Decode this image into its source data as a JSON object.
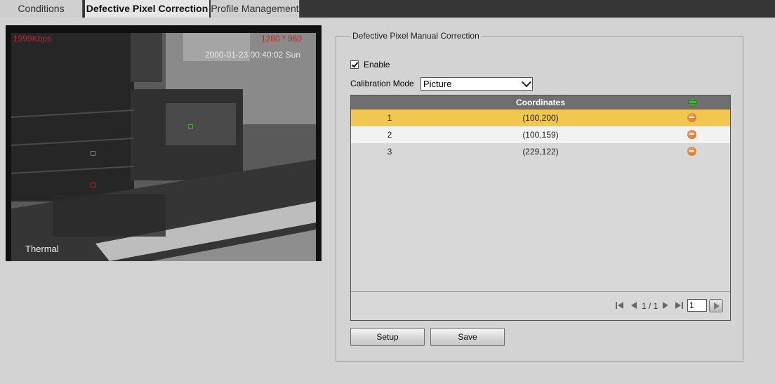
{
  "tabs": [
    {
      "label": "Conditions",
      "active": false
    },
    {
      "label": "Defective Pixel Correction",
      "active": true
    },
    {
      "label": "Profile Management",
      "active": false
    }
  ],
  "video": {
    "bitrate": "1999Kbps",
    "resolution": "1280 * 960",
    "timestamp": "2000-01-23 00:40:02 Sun",
    "channel": "Thermal"
  },
  "panel": {
    "legend": "Defective Pixel Manual Correction",
    "enable_label": "Enable",
    "enable_checked": true,
    "calibration_mode_label": "Calibration Mode",
    "calibration_mode_value": "Picture"
  },
  "table": {
    "header": "Coordinates",
    "rows": [
      {
        "index": "1",
        "coordinates": "(100,200)",
        "selected": true
      },
      {
        "index": "2",
        "coordinates": "(100,159)",
        "selected": false
      },
      {
        "index": "3",
        "coordinates": "(229,122)",
        "selected": false
      }
    ],
    "pager": {
      "label": "1 / 1",
      "page_input": "1"
    }
  },
  "buttons": {
    "setup": "Setup",
    "save": "Save"
  },
  "colors": {
    "selected_row": "#f1c84f",
    "stripe_row": "#f2f2f2",
    "header_bg": "#6f6f6f",
    "osd_red": "#c0262a"
  }
}
